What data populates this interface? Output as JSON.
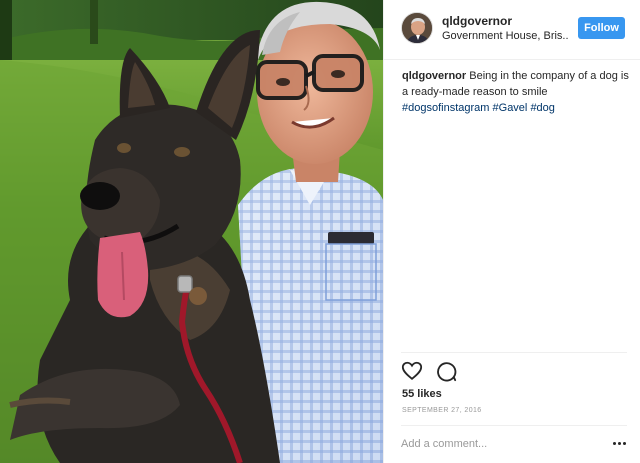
{
  "post": {
    "username": "qldgovernor",
    "location": "Government House, Bris..",
    "follow_label": "Follow",
    "caption": {
      "username": "qldgovernor",
      "text": "Being in the company of a dog is a ready-made reason to smile",
      "hashtags": [
        "#dogsofinstagram",
        "#Gavel",
        "#dog"
      ]
    },
    "likes": "55 likes",
    "date": "SEPTEMBER 27, 2016",
    "comment_placeholder": "Add a comment..."
  },
  "icons": {
    "like": "heart-icon",
    "comment": "comment-icon",
    "more": "more-options-icon"
  },
  "colors": {
    "follow_button": "#3897f0",
    "hashtag": "#003569",
    "muted": "#999999"
  }
}
